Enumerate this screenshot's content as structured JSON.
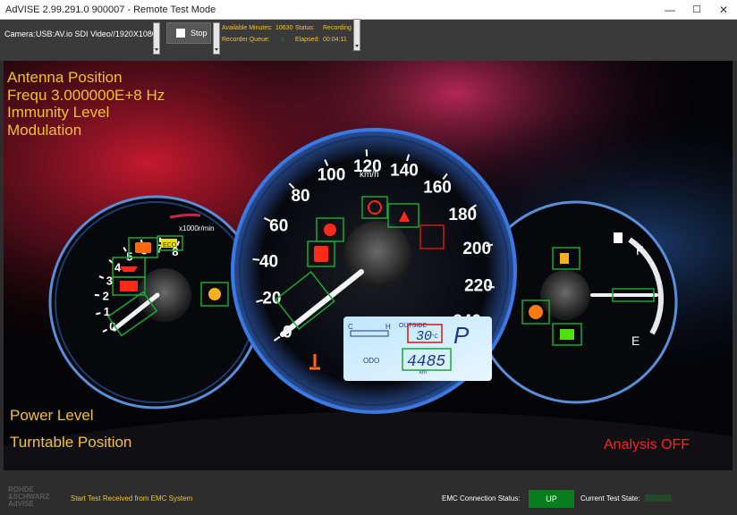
{
  "window": {
    "title": "AdVISE 2.99.291.0 900007 - Remote Test Mode",
    "controls": {
      "minimize": "—",
      "maximize": "☐",
      "close": "✕"
    }
  },
  "toolbar": {
    "camera_label": "Camera:",
    "camera_value": "USB:AV.io SDI Video//1920X1080",
    "stop_label": "Stop",
    "available_minutes_label": "Available Minutes:",
    "available_minutes_value": "10630",
    "status_label": "Status:",
    "status_value": "Recording",
    "recorder_queue_label": "Recorder Queue:",
    "recorder_queue_value": "0",
    "elapsed_label": "Elapsed:",
    "elapsed_value": "00:04:11"
  },
  "overlay": {
    "antenna_position": "Antenna Position",
    "frequency": "Frequ 3.000000E+8 Hz",
    "immunity_level": "Immunity Level",
    "modulation": "Modulation",
    "power_level": "Power Level",
    "turntable_position": "Turntable Position",
    "analysis_status": "Analysis OFF"
  },
  "dashboard": {
    "speedo_ticks": [
      "0",
      "20",
      "40",
      "60",
      "80",
      "100",
      "120",
      "140",
      "160",
      "180",
      "200",
      "220",
      "240"
    ],
    "speed_unit": "km/h",
    "tacho_ticks": [
      "0",
      "1",
      "2",
      "3",
      "4",
      "5",
      "6",
      "7",
      "8"
    ],
    "tacho_unit": "x1000r/min",
    "fuel_full": "F",
    "fuel_empty": "E",
    "display_c": "C",
    "display_h": "H",
    "outside_label": "OUTSIDE",
    "temperature": "30",
    "temperature_unit": "°C",
    "gear": "P",
    "odo_label": "ODO",
    "odometer": "4485",
    "odometer_unit": "km",
    "eco_label": "ECO"
  },
  "footer": {
    "logo_line1": "ROHDE",
    "logo_line2": "&SCHWARZ",
    "logo_line3": "AdVISE",
    "message": "Start Test Received from EMC System",
    "emc_connection_label": "EMC Connection Status:",
    "emc_connection_value": "UP",
    "current_test_state_label": "Current Test State:"
  },
  "colors": {
    "accent_yellow": "#f2c12e",
    "ok_green": "#0a7d1e",
    "warning_red": "#ff2222",
    "gauge_blue": "#2f86ff"
  }
}
